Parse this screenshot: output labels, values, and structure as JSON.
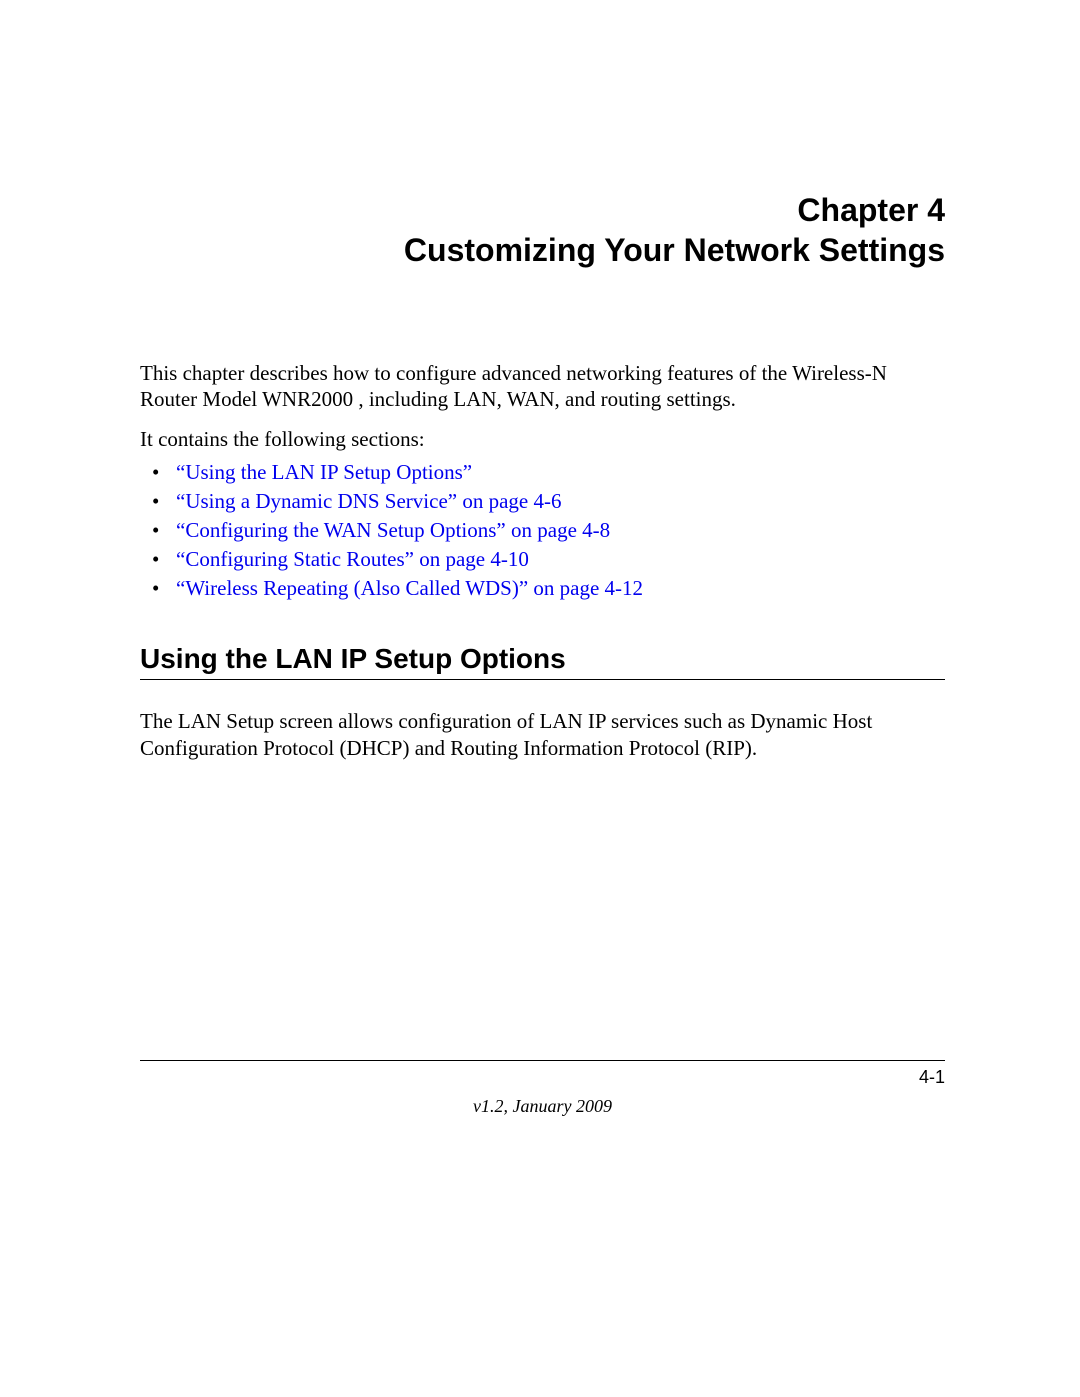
{
  "chapter": {
    "number_line": "Chapter 4",
    "title": "Customizing Your Network Settings"
  },
  "intro_paragraph": "This chapter describes how to configure advanced networking features of the Wireless-N Router Model WNR2000 , including LAN, WAN, and routing settings.",
  "list_intro": "It contains the following sections:",
  "sections": [
    {
      "label": "“Using the LAN IP Setup Options”"
    },
    {
      "label": "“Using a Dynamic DNS Service” on page 4-6"
    },
    {
      "label": "“Configuring the WAN Setup Options” on page 4-8"
    },
    {
      "label": "“Configuring Static Routes” on page 4-10"
    },
    {
      "label": "“Wireless Repeating (Also Called WDS)” on page 4-12"
    }
  ],
  "section_heading": "Using the LAN IP Setup Options",
  "section_body": "The LAN Setup screen allows configuration of LAN IP services such as Dynamic Host Configuration Protocol (DHCP) and Routing Information Protocol (RIP).",
  "footer": {
    "page_number": "4-1",
    "version_line": "v1.2, January 2009"
  }
}
